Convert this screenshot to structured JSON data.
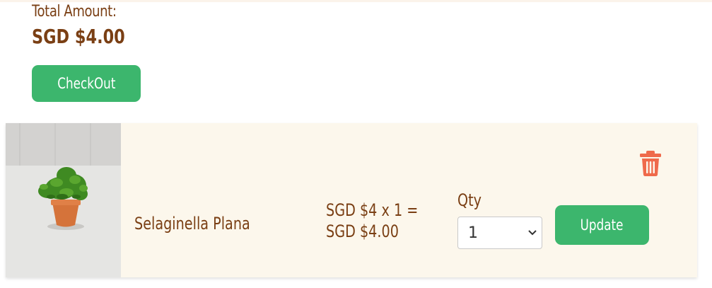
{
  "summary": {
    "total_label": "Total Amount:",
    "total_value": "SGD $4.00",
    "checkout_label": "CheckOut"
  },
  "cart": {
    "items": [
      {
        "name": "Selaginella Plana",
        "price_line1": "SGD $4 x 1 =",
        "price_line2": "SGD $4.00",
        "qty_label": "Qty",
        "qty_value": "1",
        "update_label": "Update",
        "image_icon": "potted-plant",
        "delete_icon": "trash-icon"
      }
    ]
  },
  "colors": {
    "brown_text": "#7a3f14",
    "green_button": "#3cb66d",
    "card_background": "#fcf7ec",
    "trash_red": "#ef6a4b"
  }
}
